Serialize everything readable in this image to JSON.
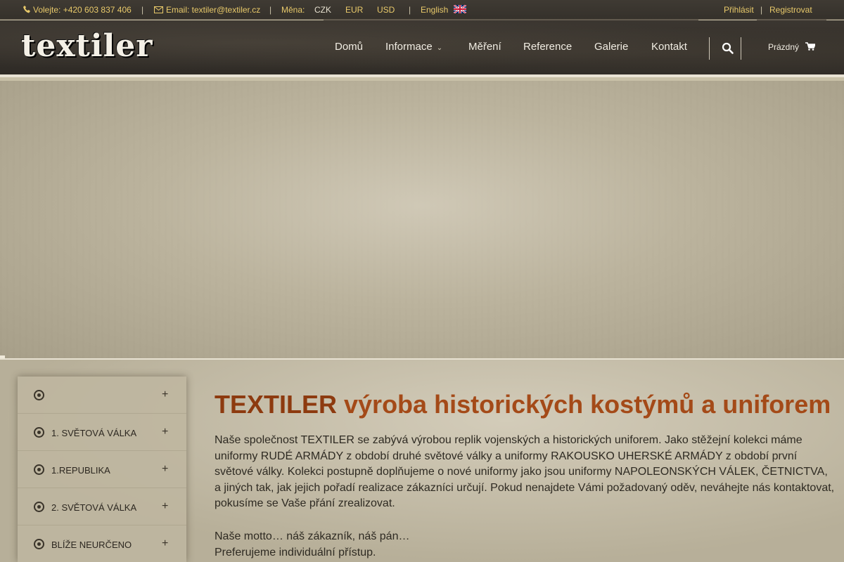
{
  "topbar": {
    "phone": "Volejte: +420 603 837 406",
    "sep1": "|",
    "email": "Email: textiler@textiler.cz",
    "sep2": "|",
    "currency_label": "Měna:",
    "currencies": [
      "CZK",
      "EUR",
      "USD"
    ],
    "sep3": "|",
    "language": "English",
    "login": "Přihlásit",
    "sep4": "|",
    "register": "Registrovat"
  },
  "header": {
    "logo": "textiler",
    "menu": [
      "Domů",
      "Informace",
      "Měření",
      "Reference",
      "Galerie",
      "Kontakt"
    ],
    "cart_label": "Prázdný"
  },
  "sidebar": {
    "items": [
      {
        "label": ""
      },
      {
        "label": "1. SVĚTOVÁ VÁLKA"
      },
      {
        "label": "1.REPUBLIKA"
      },
      {
        "label": "2. SVĚTOVÁ VÁLKA"
      },
      {
        "label": "BLÍŽE NEURČENO"
      }
    ],
    "expand_symbol": "+"
  },
  "main": {
    "headline_bold": "TEXTILER",
    "headline_rest": " výroba historických kostýmů a uniforem",
    "paragraph": "Naše společnost TEXTILER se zabývá výrobou replik vojenských a historických uniforem. Jako stěžejní kolekci máme uniformy RUDÉ ARMÁDY z období druhé světové války a uniformy RAKOUSKO UHERSKÉ ARMÁDY z období první světové války. Kolekci postupně doplňujeme o nové uniformy jako jsou uniformy NAPOLEONSKÝCH VÁLEK, ČETNICTVA, a jiných tak, jak jejich pořadí realizace zákazníci určují. Pokud nenajdete Vámi požadovaný oděv, neváhejte nás kontaktovat, pokusíme se Vaše přání zrealizovat.",
    "motto_1": "Naše motto… náš zákazník, náš pán…",
    "motto_2": "Preferujeme individuální přístup."
  },
  "colors": {
    "accent_gold": "#e8c96a",
    "headline_rust": "#9a3d12",
    "header_dark": "#35312b"
  },
  "icons": [
    "phone-icon",
    "envelope-icon",
    "uk-flag-icon",
    "search-icon",
    "cart-icon",
    "chevron-down-icon",
    "dot-circle-icon"
  ]
}
